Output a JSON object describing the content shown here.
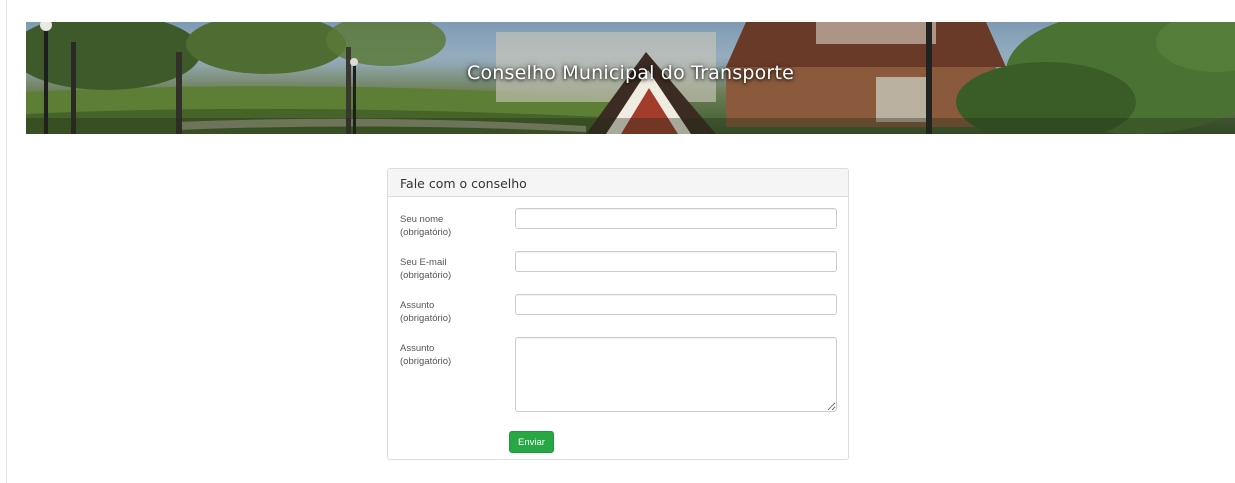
{
  "banner": {
    "title": "Conselho Municipal do Transporte"
  },
  "form": {
    "heading": "Fale com o conselho",
    "fields": [
      {
        "label": "Seu nome",
        "required": "(obrigatório)",
        "value": "",
        "type": "text"
      },
      {
        "label": "Seu E-mail",
        "required": "(obrigatório)",
        "value": "",
        "type": "text"
      },
      {
        "label": "Assunto",
        "required": "(obrigatório)",
        "value": "",
        "type": "text"
      },
      {
        "label": "Assunto",
        "required": "(obrigatório)",
        "value": "",
        "type": "textarea"
      }
    ],
    "submit_label": "Enviar"
  },
  "colors": {
    "submit_button": "#28a745",
    "panel_heading_bg": "#f5f5f5",
    "panel_border": "#dcdcdc"
  }
}
